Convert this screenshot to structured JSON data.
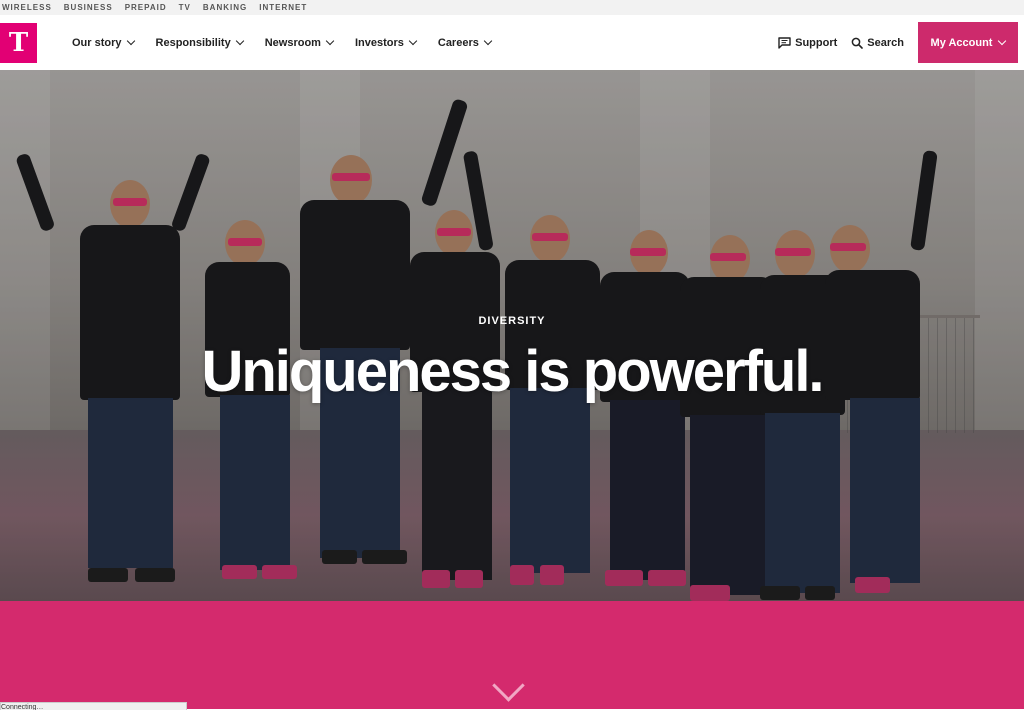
{
  "utility_nav": [
    "WIRELESS",
    "BUSINESS",
    "PREPAID",
    "TV",
    "BANKING",
    "INTERNET"
  ],
  "logo": {
    "text": "T",
    "color": "#e20074"
  },
  "main_nav": [
    {
      "label": "Our story"
    },
    {
      "label": "Responsibility"
    },
    {
      "label": "Newsroom"
    },
    {
      "label": "Investors"
    },
    {
      "label": "Careers"
    }
  ],
  "support_label": "Support",
  "search_label": "Search",
  "account_label": "My Account",
  "hero": {
    "eyebrow": "DIVERSITY",
    "headline": "Uniqueness is powerful."
  },
  "status_text": "Connecting…",
  "colors": {
    "brand": "#e20074",
    "account_button": "#cd2a6c",
    "pink_band": "#d42a6d"
  }
}
